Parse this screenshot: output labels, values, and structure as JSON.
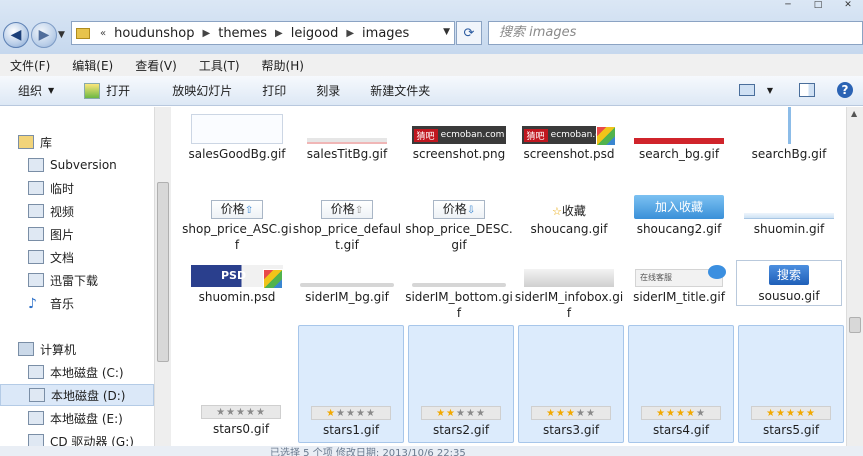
{
  "window": {
    "breadcrumbs": [
      "houdunshop",
      "themes",
      "leigood",
      "images"
    ],
    "search_placeholder": "搜索 images",
    "overflow_chevron": "«"
  },
  "menu": [
    "文件(F)",
    "编辑(E)",
    "查看(V)",
    "工具(T)",
    "帮助(H)"
  ],
  "commands": {
    "organize": "组织",
    "open": "打开",
    "slideshow": "放映幻灯片",
    "print": "打印",
    "burn": "刻录",
    "new_folder": "新建文件夹"
  },
  "nav": {
    "library": "库",
    "items": [
      "Subversion",
      "临时",
      "视频",
      "图片",
      "文档",
      "迅雷下载",
      "音乐"
    ],
    "computer": "计算机",
    "drives": [
      "本地磁盘 (C:)",
      "本地磁盘 (D:)",
      "本地磁盘 (E:)",
      "CD 驱动器 (G:)"
    ]
  },
  "files": {
    "row1": [
      "salesGoodBg.gif",
      "salesTitBg.gif",
      "screenshot.png",
      "screenshot.psd",
      "search_bg.gif",
      "searchBg.gif"
    ],
    "row2": [
      "shop_price_ASC.gif",
      "shop_price_default.gif",
      "shop_price_DESC.gif",
      "shoucang.gif",
      "shoucang2.gif",
      "shuomin.gif"
    ],
    "row3": [
      "shuomin.psd",
      "siderIM_bg.gif",
      "siderIM_bottom.gif",
      "siderIM_infobox.gif",
      "siderIM_title.gif",
      "sousuo.gif"
    ],
    "row4": [
      "stars0.gif",
      "stars1.gif",
      "stars2.gif",
      "stars3.gif",
      "stars4.gif",
      "stars5.gif"
    ]
  },
  "thumb_text": {
    "price": "价格",
    "shoucang": "收藏",
    "shoucang2": "加入收藏",
    "psd": "PSD",
    "sousuo": "搜索",
    "ecmoban": "ecmoban.com"
  },
  "stars_filled": [
    0,
    1,
    2,
    3,
    4,
    5
  ],
  "selected_files": [
    "stars1.gif",
    "stars2.gif",
    "stars3.gif",
    "stars4.gif",
    "stars5.gif"
  ],
  "status": "已选择 5 个项  修改日期: 2013/10/6 22:35"
}
